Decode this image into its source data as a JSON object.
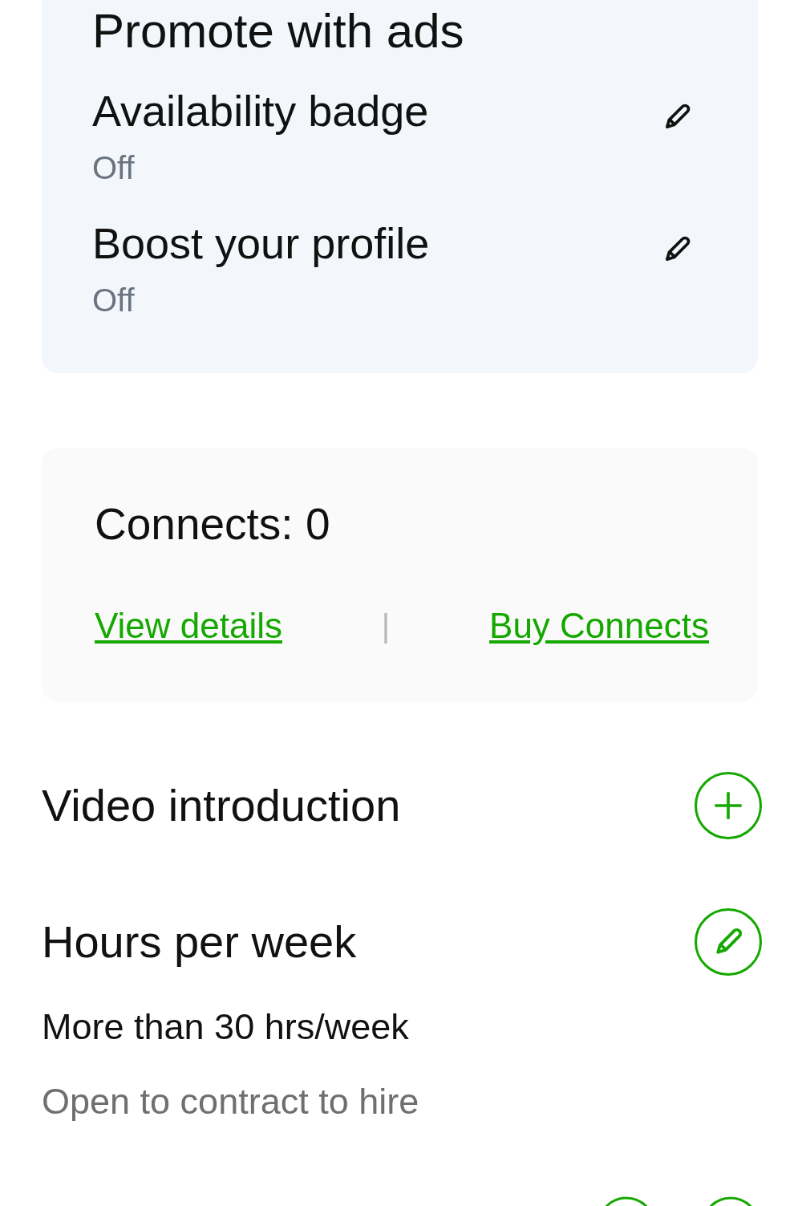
{
  "promote_card": {
    "title": "Promote with ads",
    "items": [
      {
        "label": "Availability badge",
        "status": "Off"
      },
      {
        "label": "Boost your profile",
        "status": "Off"
      }
    ]
  },
  "connects_card": {
    "title": "Connects: 0",
    "links": [
      "View details",
      "Buy Connects"
    ],
    "separator": "|"
  },
  "sections": [
    {
      "title": "Video introduction",
      "kind": "add"
    },
    {
      "title": "Hours per week",
      "kind": "edit",
      "value": "More than 30 hrs/week",
      "note": "Open to contract to hire"
    }
  ]
}
